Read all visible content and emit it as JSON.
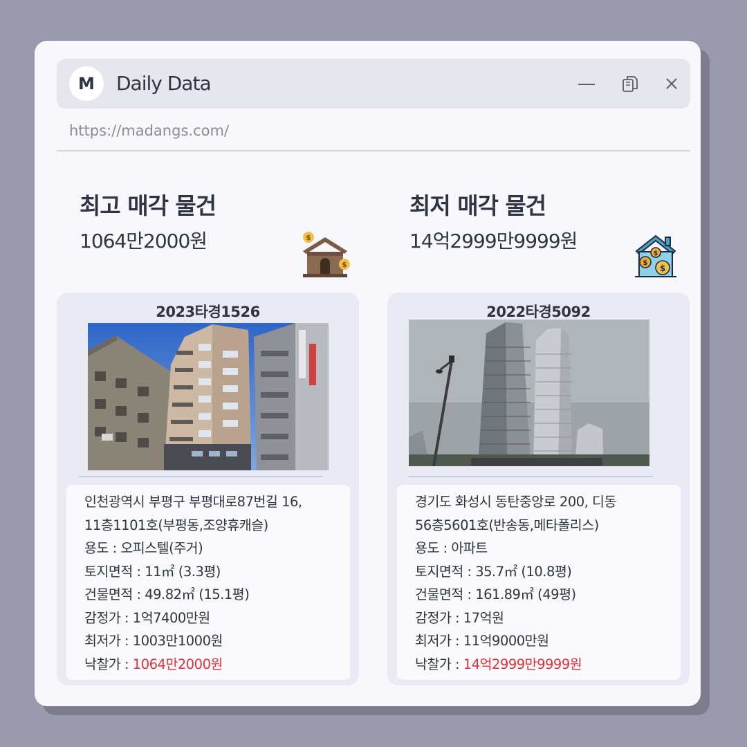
{
  "app": {
    "logo_letter": "M",
    "title": "Daily Data",
    "url": "https://madangs.com/"
  },
  "left": {
    "heading": "최고 매각 물건",
    "price": "1064만2000원",
    "card": {
      "case_no": "2023타경1526",
      "address_line1": "인천광역시 부평구 부평대로87번길 16,",
      "address_line2": "11층1101호(부평동,조양휴캐슬)",
      "usage": "용도 : 오피스텔(주거)",
      "land_area": "토지면적 : 11㎡ (3.3평)",
      "building_area": "건물면적 : 49.82㎡ (15.1평)",
      "appraisal": "감정가 : 1억7400만원",
      "minimum": "최저가 : 1003만1000원",
      "winning_label": "낙찰가 : ",
      "winning_value": "1064만2000원"
    }
  },
  "right": {
    "heading": "최저 매각 물건",
    "price": "14억2999만9999원",
    "card": {
      "case_no": "2022타경5092",
      "address_line1": "경기도 화성시 동탄중앙로 200, 디동",
      "address_line2": "56층5601호(반송동,메타폴리스)",
      "usage": "용도 : 아파트",
      "land_area": "토지면적 : 35.7㎡ (10.8평)",
      "building_area": "건물면적 : 161.89㎡ (49평)",
      "appraisal": "감정가 : 17억원",
      "minimum": "최저가 : 11억9000만원",
      "winning_label": "낙찰가 : ",
      "winning_value": "14억2999만9999원"
    }
  },
  "icons": {
    "minimize": "minimize-icon",
    "copy": "copy-icon",
    "close": "close-icon",
    "left_badge": "house-money-icon",
    "right_badge": "house-coins-icon"
  },
  "colors": {
    "background": "#9a9aae",
    "window": "#f8f8fc",
    "titlebar": "#e5e6ee",
    "card": "#e9eaf4",
    "text": "#2f3442",
    "accent_red": "#e0343a"
  }
}
